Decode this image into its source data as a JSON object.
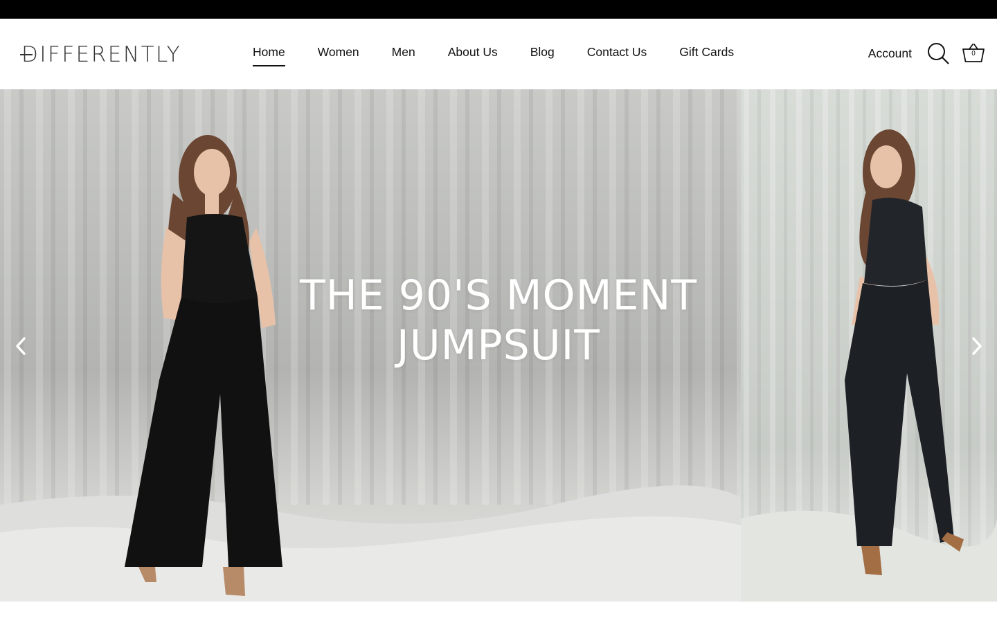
{
  "brand": {
    "name": "DIFFERENTLY",
    "first_letter": "D",
    "rest": "IFFERENTLY"
  },
  "nav": {
    "items": [
      {
        "label": "Home",
        "active": true
      },
      {
        "label": "Women"
      },
      {
        "label": "Men"
      },
      {
        "label": "About Us"
      },
      {
        "label": "Blog"
      },
      {
        "label": "Contact Us"
      },
      {
        "label": "Gift Cards"
      }
    ]
  },
  "header": {
    "account_label": "Account",
    "search_icon": "search-icon",
    "cart_icon": "basket-icon",
    "cart_count": "0"
  },
  "hero": {
    "title_line1": "THE 90'S MOMENT",
    "title_line2": "JUMPSUIT",
    "prev_icon": "chevron-left-icon",
    "next_icon": "chevron-right-icon"
  },
  "colors": {
    "announcement_bar": "#000000",
    "header_bg": "#ffffff",
    "text": "#111111",
    "hero_title": "#ffffff"
  }
}
